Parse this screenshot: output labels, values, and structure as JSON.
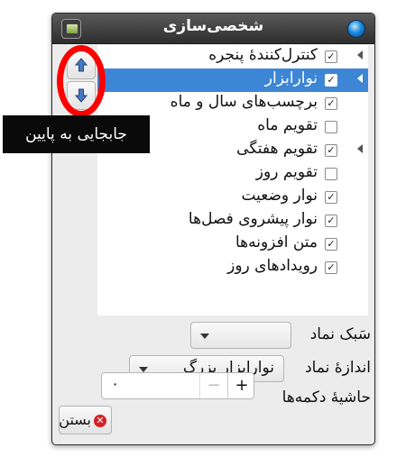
{
  "window": {
    "title": "شخصی‌سازی"
  },
  "toolbar_items": [
    {
      "label": "کنترل‌کنندهٔ پنجره",
      "checked": true,
      "has_submenu": true,
      "selected": false
    },
    {
      "label": "نوارابزار",
      "checked": true,
      "has_submenu": true,
      "selected": true
    },
    {
      "label": "برچسب‌های سال و ماه",
      "checked": true,
      "has_submenu": false,
      "selected": false
    },
    {
      "label": "تقویم ماه",
      "checked": false,
      "has_submenu": false,
      "selected": false
    },
    {
      "label": "تقویم هفتگی",
      "checked": true,
      "has_submenu": true,
      "selected": false
    },
    {
      "label": "تقویم روز",
      "checked": false,
      "has_submenu": false,
      "selected": false
    },
    {
      "label": "نوار وضعیت",
      "checked": true,
      "has_submenu": false,
      "selected": false
    },
    {
      "label": "نوار پیشروی فصل‌ها",
      "checked": true,
      "has_submenu": false,
      "selected": false
    },
    {
      "label": "متن افزونه‌ها",
      "checked": true,
      "has_submenu": false,
      "selected": false
    },
    {
      "label": "رویدادهای روز",
      "checked": true,
      "has_submenu": false,
      "selected": false
    }
  ],
  "tooltip": {
    "text": "جابجایی به پایین"
  },
  "icon_style": {
    "label": "سَبک نماد",
    "value": ""
  },
  "icon_size": {
    "label": "اندازهٔ نماد",
    "value": "نوارابزار بزرگ"
  },
  "button_border": {
    "label": "حاشیهٔ دکمه‌ها",
    "value": "۰",
    "plus": "+",
    "minus": "−"
  },
  "close_button": {
    "label": "بستن"
  },
  "colors": {
    "selection": "#3d86d6",
    "annotation": "#ff0000",
    "close_icon": "#d42222"
  }
}
